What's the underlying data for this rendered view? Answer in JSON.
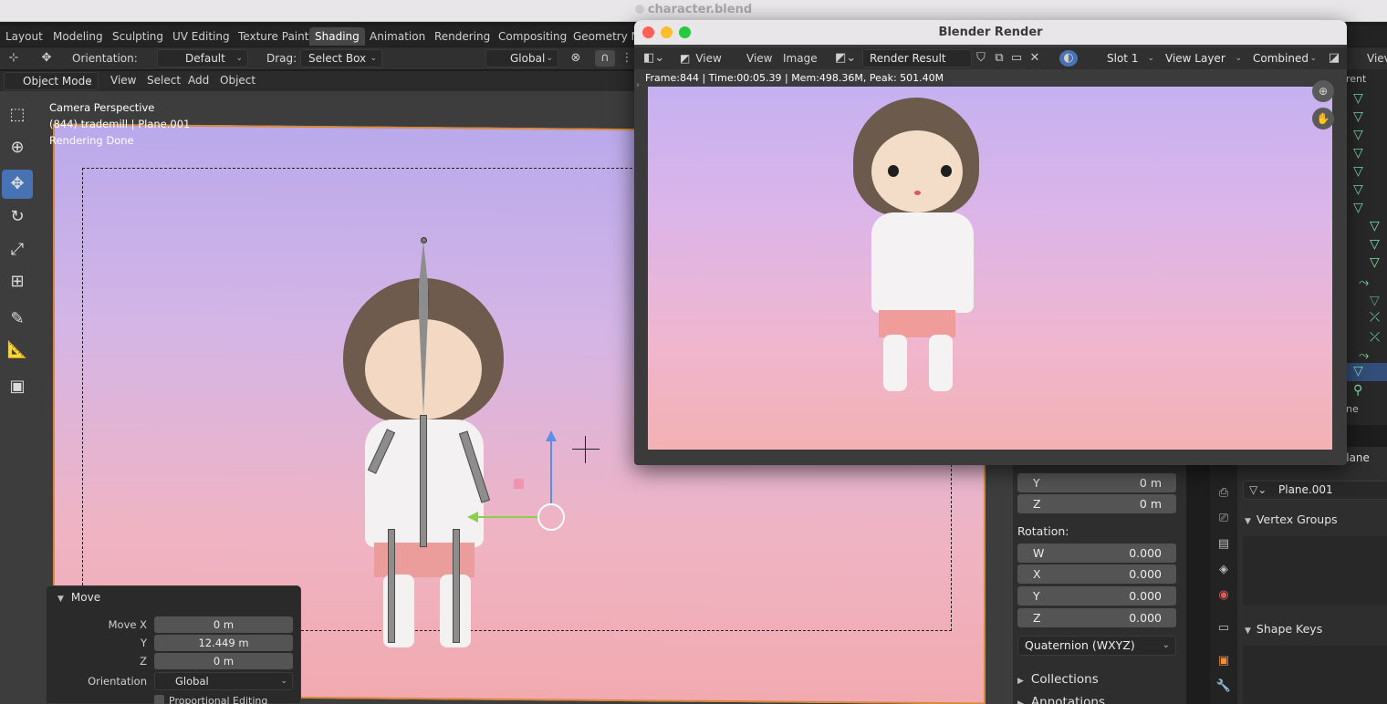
{
  "window": {
    "title": "character.blend"
  },
  "workspaces": [
    "Layout",
    "Modeling",
    "Sculpting",
    "UV Editing",
    "Texture Paint",
    "Shading",
    "Animation",
    "Rendering",
    "Compositing",
    "Geometry No"
  ],
  "tool_header": {
    "orientation_label": "Orientation:",
    "orientation_value": "Default",
    "drag_label": "Drag:",
    "drag_value": "Select Box",
    "transform_orientation": "Global",
    "view_label_right": "Viev"
  },
  "viewport_header": {
    "mode": "Object Mode",
    "menus": [
      "View",
      "Select",
      "Add",
      "Object"
    ]
  },
  "viewport_info": {
    "line1": "Camera Perspective",
    "line2": "(844) trademill | Plane.001",
    "line3": "Rendering Done"
  },
  "move_panel": {
    "title": "Move",
    "move_x_label": "Move X",
    "move_x": "0 m",
    "y_label": "Y",
    "y": "12.449 m",
    "z_label": "Z",
    "z": "0 m",
    "orientation_label": "Orientation",
    "orientation_value": "Global",
    "proportional_label": "Proportional Editing"
  },
  "transform_panel": {
    "y_axis": "Y",
    "y_value": "0 m",
    "z_axis": "Z",
    "z_value": "0 m",
    "rotation_label": "Rotation:",
    "rotation": [
      {
        "axis": "W",
        "value": "0.000"
      },
      {
        "axis": "X",
        "value": "0.000"
      },
      {
        "axis": "Y",
        "value": "0.000"
      },
      {
        "axis": "Z",
        "value": "0.000"
      }
    ],
    "rotation_mode": "Quaternion (WXYZ)",
    "collections_label": "Collections",
    "annotations_label": "Annotations"
  },
  "properties": {
    "header_label": "Plane",
    "object_name": "Plane.001",
    "vertex_groups_label": "Vertex Groups",
    "shape_keys_label": "Shape Keys"
  },
  "outliner": {
    "header_label": "rent",
    "row_label": "ne"
  },
  "render_window": {
    "title": "Blender Render",
    "menus": [
      "View",
      "View",
      "Image"
    ],
    "image_name": "Render Result",
    "slot": "Slot 1",
    "view_layer": "View Layer",
    "pass": "Combined",
    "stats": "Frame:844 | Time:00:05.39 | Mem:498.36M, Peak: 501.40M"
  },
  "colors": {
    "accent_blue": "#4772b3",
    "render_bg_top": "#c5b1f0",
    "render_bg_bottom": "#f3b1b3"
  }
}
